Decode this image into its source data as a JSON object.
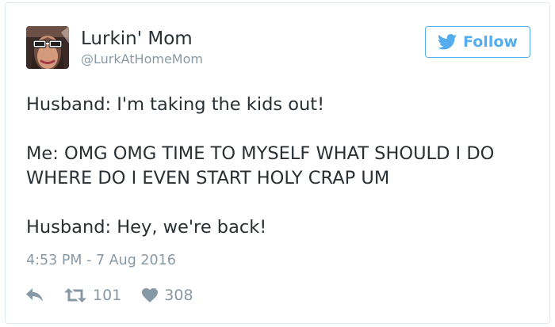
{
  "user": {
    "display_name": "Lurkin' Mom",
    "handle": "@LurkAtHomeMom",
    "avatar_icon": "profile-photo"
  },
  "follow_button": {
    "label": "Follow",
    "icon": "twitter-bird-icon",
    "color": "#55acee"
  },
  "tweet": {
    "lines": [
      "Husband: I'm taking the kids out!",
      "",
      "Me: OMG OMG TIME TO MYSELF WHAT SHOULD I DO",
      "WHERE DO I EVEN START HOLY CRAP UM",
      "",
      "Husband: Hey, we're back!"
    ]
  },
  "timestamp": "4:53 PM - 7 Aug 2016",
  "actions": {
    "reply_icon": "reply-arrow-icon",
    "retweet_icon": "retweet-icon",
    "retweet_count": "101",
    "like_icon": "heart-icon",
    "like_count": "308"
  },
  "colors": {
    "text": "#292f33",
    "muted": "#8899a6",
    "accent": "#55acee",
    "border": "#e1e8ed"
  }
}
